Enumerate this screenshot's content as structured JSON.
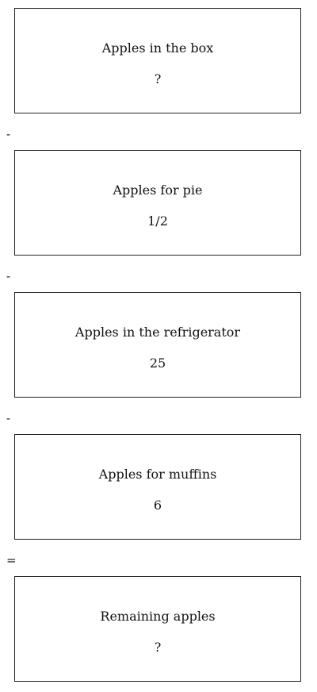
{
  "boxes": [
    {
      "label": "Apples in the box",
      "value": "?"
    },
    {
      "label": "Apples for pie",
      "value": "1/2"
    },
    {
      "label": "Apples in the refrigerator",
      "value": "25"
    },
    {
      "label": "Apples for muffins",
      "value": "6"
    },
    {
      "label": "Remaining apples",
      "value": "?"
    }
  ],
  "operators": [
    "-",
    "-",
    "-",
    "="
  ]
}
